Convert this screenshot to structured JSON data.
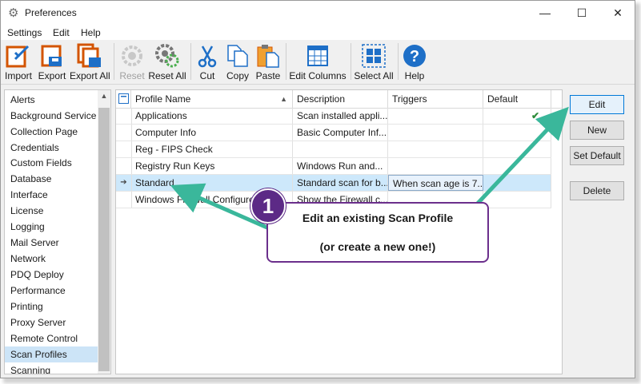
{
  "window": {
    "title": "Preferences",
    "minimize": "—",
    "maximize": "☐",
    "close": "✕"
  },
  "menu": [
    "Settings",
    "Edit",
    "Help"
  ],
  "toolbar": [
    {
      "label": "Import",
      "icon": "import-icon",
      "disabled": false
    },
    {
      "label": "Export",
      "icon": "export-icon",
      "disabled": false
    },
    {
      "label": "Export All",
      "icon": "export-all-icon",
      "disabled": false
    },
    {
      "label": "Reset",
      "icon": "reset-icon",
      "disabled": true
    },
    {
      "label": "Reset All",
      "icon": "reset-all-icon",
      "disabled": false
    },
    {
      "label": "Cut",
      "icon": "cut-icon",
      "disabled": false
    },
    {
      "label": "Copy",
      "icon": "copy-icon",
      "disabled": false
    },
    {
      "label": "Paste",
      "icon": "paste-icon",
      "disabled": false
    },
    {
      "label": "Edit Columns",
      "icon": "edit-columns-icon",
      "disabled": false
    },
    {
      "label": "Select All",
      "icon": "select-all-icon",
      "disabled": false
    },
    {
      "label": "Help",
      "icon": "help-icon",
      "disabled": false
    }
  ],
  "sidebar": {
    "items": [
      "Alerts",
      "Background Service",
      "Collection Page",
      "Credentials",
      "Custom Fields",
      "Database",
      "Interface",
      "License",
      "Logging",
      "Mail Server",
      "Network",
      "PDQ Deploy",
      "Performance",
      "Printing",
      "Proxy Server",
      "Remote Control",
      "Scan Profiles",
      "Scanning"
    ],
    "selected": "Scan Profiles"
  },
  "grid": {
    "columns": [
      "Profile Name",
      "Description",
      "Triggers",
      "Default"
    ],
    "sort_indicator": "▲",
    "rows": [
      {
        "name": "Applications",
        "description": "Scan installed appli...",
        "triggers": "",
        "default": "✔"
      },
      {
        "name": "Computer Info",
        "description": "Basic Computer Inf...",
        "triggers": "",
        "default": ""
      },
      {
        "name": "Reg - FIPS Check",
        "description": "",
        "triggers": "",
        "default": ""
      },
      {
        "name": "Registry Run Keys",
        "description": "Windows Run and...",
        "triggers": "",
        "default": ""
      },
      {
        "name": "Standard",
        "description": "Standard scan for b...",
        "triggers": "When scan age is 7...",
        "default": ""
      },
      {
        "name": "Windows Firewall Configure",
        "description": "Show the Firewall c...",
        "triggers": "",
        "default": ""
      }
    ],
    "selected_row_indicator": "➔"
  },
  "buttons": {
    "edit": "Edit",
    "new": "New",
    "set_default": "Set Default",
    "delete": "Delete"
  },
  "callout": {
    "number": "1",
    "line1": "Edit an existing Scan Profile",
    "line2": "(or create a new one!)"
  },
  "colors": {
    "accent": "#0078d7",
    "callout_border": "#6b2f8c",
    "badge": "#5c2a86",
    "arrow": "#3ab79b",
    "check": "#2e8b3a"
  }
}
